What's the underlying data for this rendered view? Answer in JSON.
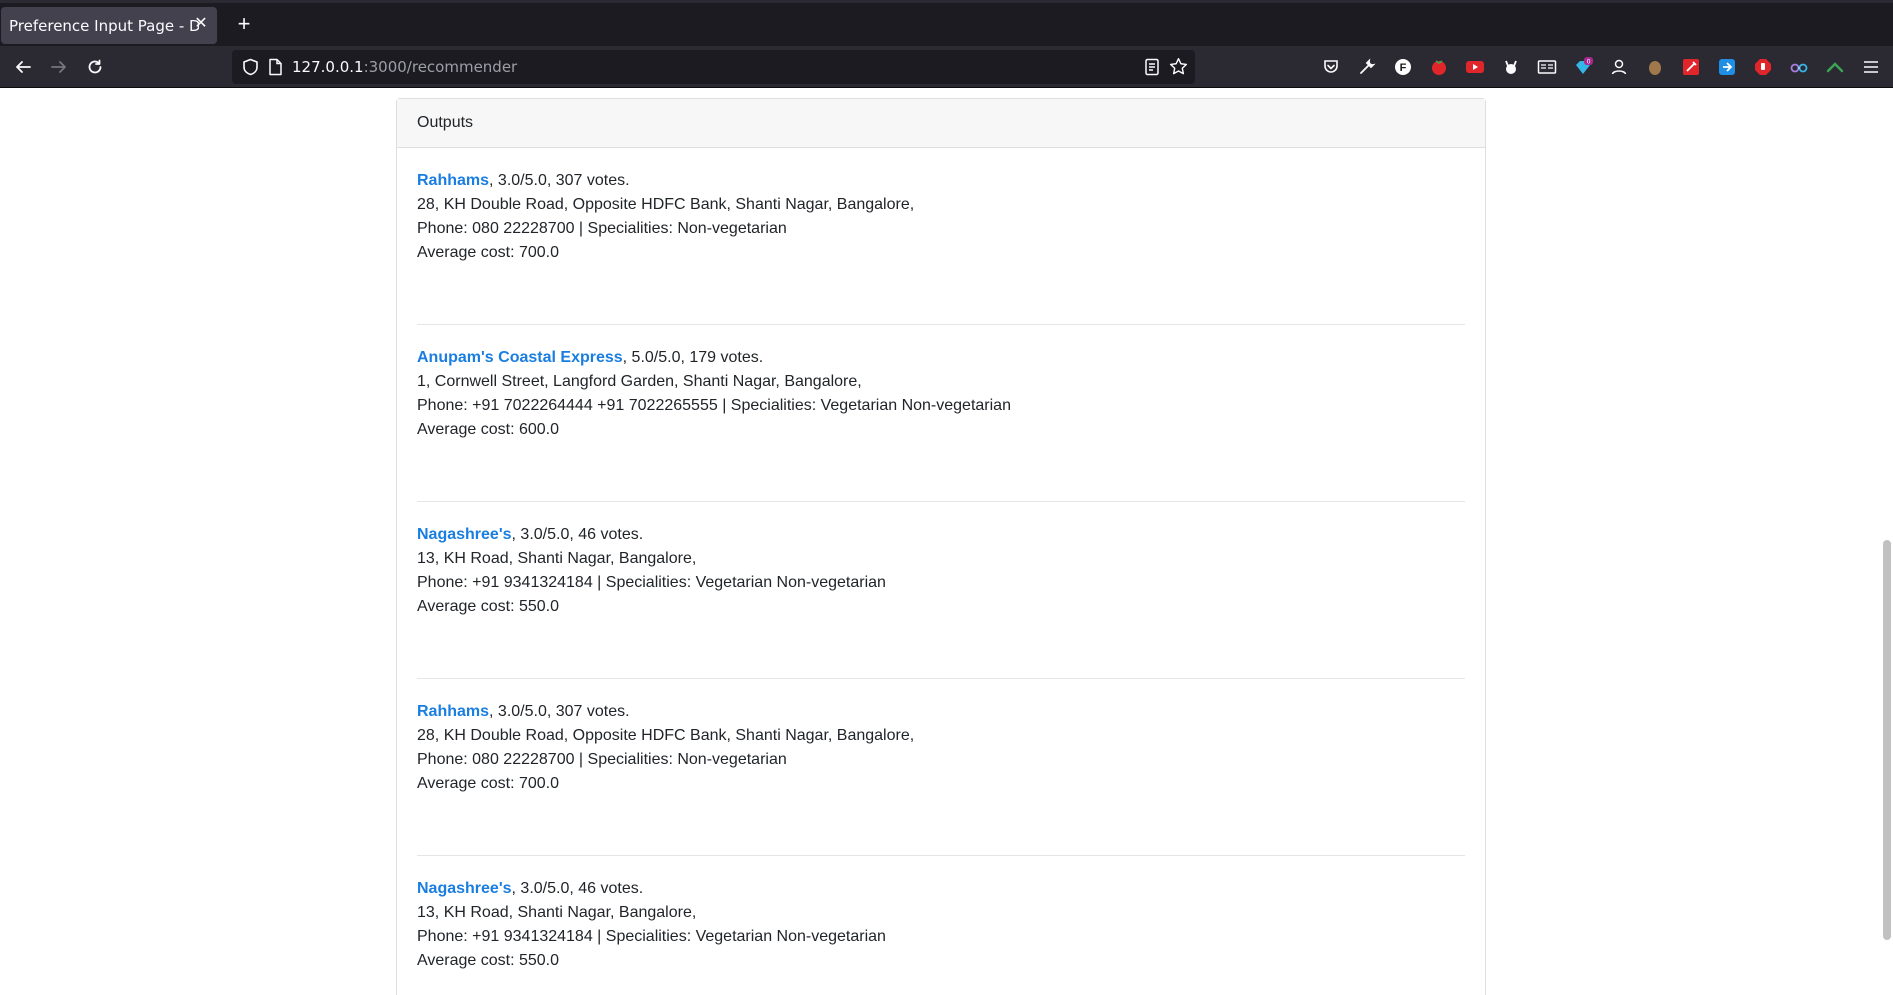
{
  "browser": {
    "tab_title": "Preference Input Page - DWDM",
    "url_host": "127.0.0.1",
    "url_rest": ":3000/recommender"
  },
  "icons": {
    "back": "arrow-left-icon",
    "forward": "arrow-right-icon",
    "reload": "reload-icon",
    "shield": "shield-icon",
    "page": "page-icon",
    "reader": "reader-view-icon",
    "bookmark": "star-icon",
    "menu": "hamburger-icon"
  },
  "extensions": [
    {
      "name": "pocket-icon",
      "color": "#fbfbfe"
    },
    {
      "name": "wrench-icon",
      "color": "#fbfbfe"
    },
    {
      "name": "f-extension-icon",
      "color": "#ffffff"
    },
    {
      "name": "tomato-icon",
      "color": "#e0262b"
    },
    {
      "name": "video-extension-icon",
      "color": "#e0262b"
    },
    {
      "name": "devil-icon",
      "color": "#fbfbfe"
    },
    {
      "name": "reader-extension-icon",
      "color": "#fbfbfe"
    },
    {
      "name": "badge-extension-icon",
      "color": "#35b6e8",
      "badge": "0"
    },
    {
      "name": "profile-extension-icon",
      "color": "#fbfbfe"
    },
    {
      "name": "hand-extension-icon",
      "color": "#a0784c"
    },
    {
      "name": "tool-extension-icon",
      "color": "#e0262b"
    },
    {
      "name": "share-extension-icon",
      "color": "#1f8fe6"
    },
    {
      "name": "stop-extension-icon",
      "color": "#e0262b"
    },
    {
      "name": "glasses-extension-icon",
      "color": "#a87ee0"
    },
    {
      "name": "leaf-extension-icon",
      "color": "#3aa655"
    }
  ],
  "card": {
    "header": "Outputs"
  },
  "results": [
    {
      "name": "Rahhams",
      "rating": ", 3.0/5.0, 307 votes.",
      "address": "28, KH Double Road, Opposite HDFC Bank, Shanti Nagar, Bangalore,",
      "phone_line": "Phone: 080 22228700 | Specialities: Non-vegetarian",
      "cost": "Average cost: 700.0"
    },
    {
      "name": "Anupam's Coastal Express",
      "rating": ", 5.0/5.0, 179 votes.",
      "address": "1, Cornwell Street, Langford Garden, Shanti Nagar, Bangalore,",
      "phone_line": "Phone: +91 7022264444 +91 7022265555 | Specialities: Vegetarian Non-vegetarian",
      "cost": "Average cost: 600.0"
    },
    {
      "name": "Nagashree's",
      "rating": ", 3.0/5.0, 46 votes.",
      "address": "13, KH Road, Shanti Nagar, Bangalore,",
      "phone_line": "Phone: +91 9341324184 | Specialities: Vegetarian Non-vegetarian",
      "cost": "Average cost: 550.0"
    },
    {
      "name": "Rahhams",
      "rating": ", 3.0/5.0, 307 votes.",
      "address": "28, KH Double Road, Opposite HDFC Bank, Shanti Nagar, Bangalore,",
      "phone_line": "Phone: 080 22228700 | Specialities: Non-vegetarian",
      "cost": "Average cost: 700.0"
    },
    {
      "name": "Nagashree's",
      "rating": ", 3.0/5.0, 46 votes.",
      "address": "13, KH Road, Shanti Nagar, Bangalore,",
      "phone_line": "Phone: +91 9341324184 | Specialities: Vegetarian Non-vegetarian",
      "cost": "Average cost: 550.0"
    }
  ]
}
